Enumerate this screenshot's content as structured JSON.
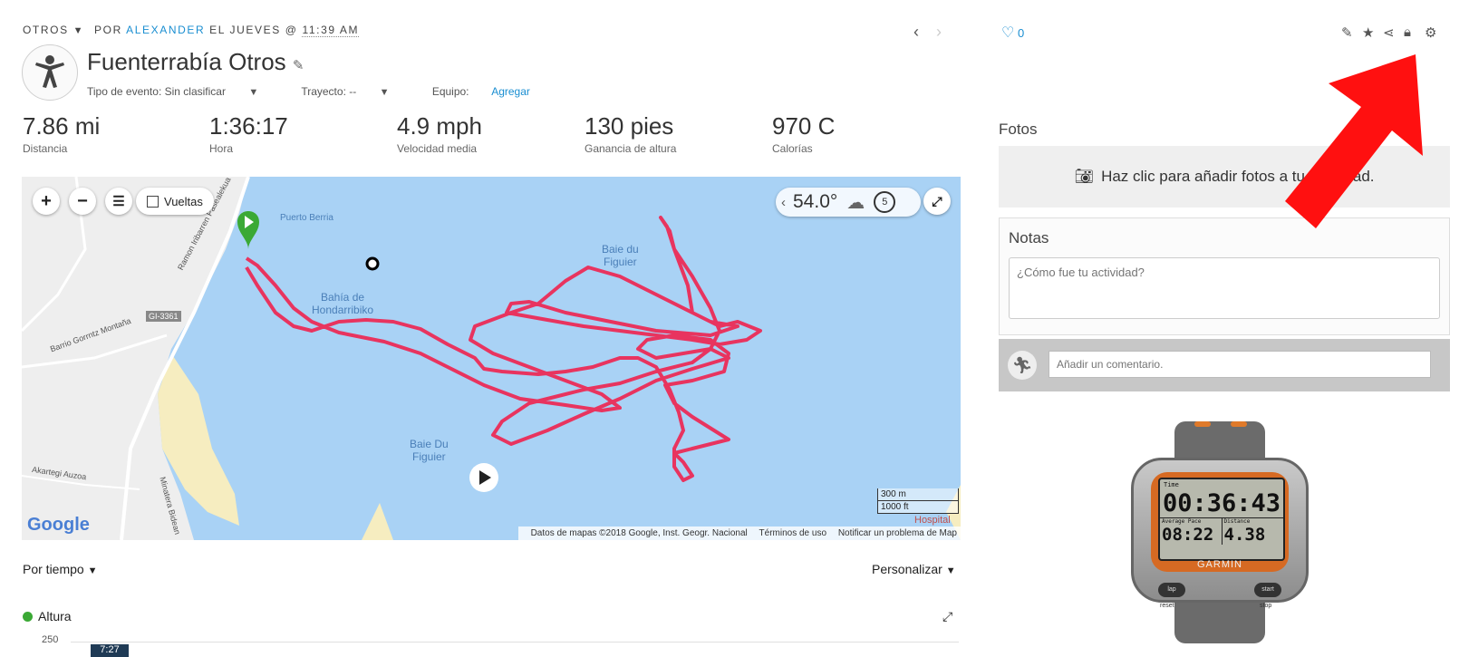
{
  "header": {
    "type_label": "OTROS",
    "by_label": "POR",
    "user_name": "ALEXANDER",
    "when_label": "EL JUEVES @",
    "time": "11:39 AM"
  },
  "activity": {
    "title": "Fuenterrabía Otros",
    "event_type_label": "Tipo de evento: Sin clasificar",
    "course_label": "Trayecto: --",
    "gear_label": "Equipo:",
    "gear_link": "Agregar"
  },
  "stats": [
    {
      "value": "7.86 mi",
      "label": "Distancia"
    },
    {
      "value": "1:36:17",
      "label": "Hora"
    },
    {
      "value": "4.9 mph",
      "label": "Velocidad media"
    },
    {
      "value": "130 pies",
      "label": "Ganancia de altura"
    },
    {
      "value": "970 C",
      "label": "Calorías"
    }
  ],
  "map": {
    "laps_label": "Vueltas",
    "temperature": "54.0°",
    "timer_value": "5",
    "place_labels": {
      "puerto": "Puerto Berria",
      "bahia_1": "Bahía de",
      "bahia_2": "Hondarribiko",
      "baie_top_1": "Baie du",
      "baie_top_2": "Figuier",
      "baie_bottom_1": "Baie Du",
      "baie_bottom_2": "Figuier",
      "road_code": "GI-3361",
      "road_1": "Ramon Iribarren Pasealekua",
      "road_2": "Barrio Gorrntz Montaña",
      "road_3": "Akartegi Auzoa",
      "road_4": "Minatera Bidean",
      "hospital": "Hospital"
    },
    "scale_m": "300 m",
    "scale_ft": "1000 ft",
    "google_label": "Google",
    "attribution": "Datos de mapas ©2018 Google, Inst. Geogr. Nacional",
    "terms": "Términos de uso",
    "report": "Notificar un problema de Map"
  },
  "social": {
    "likes": "0"
  },
  "photos": {
    "title": "Fotos",
    "add_text": "Haz clic para añadir fotos a tu actividad."
  },
  "notes": {
    "title": "Notas",
    "placeholder": "¿Cómo fue tu actividad?"
  },
  "comment": {
    "placeholder": "Añadir un comentario."
  },
  "device": {
    "top_label": "Time",
    "time": "00:36:43",
    "pace_label": "Average Pace",
    "pace": "08:22",
    "distance_label": "Distance",
    "distance": "4.38",
    "brand": "GARMIN",
    "btn_lap": "lap",
    "btn_start": "start",
    "btn_reset": "reset",
    "btn_stop": "stop"
  },
  "chart_controls": {
    "by_time": "Por tiempo",
    "customize": "Personalizar",
    "legend": "Altura",
    "y_tick": "250",
    "tooltip": "7:27"
  },
  "colors": {
    "accent": "#1a8ed1",
    "track": "#e8345f",
    "water": "#a9d2f5",
    "arrow": "#ff1010"
  }
}
